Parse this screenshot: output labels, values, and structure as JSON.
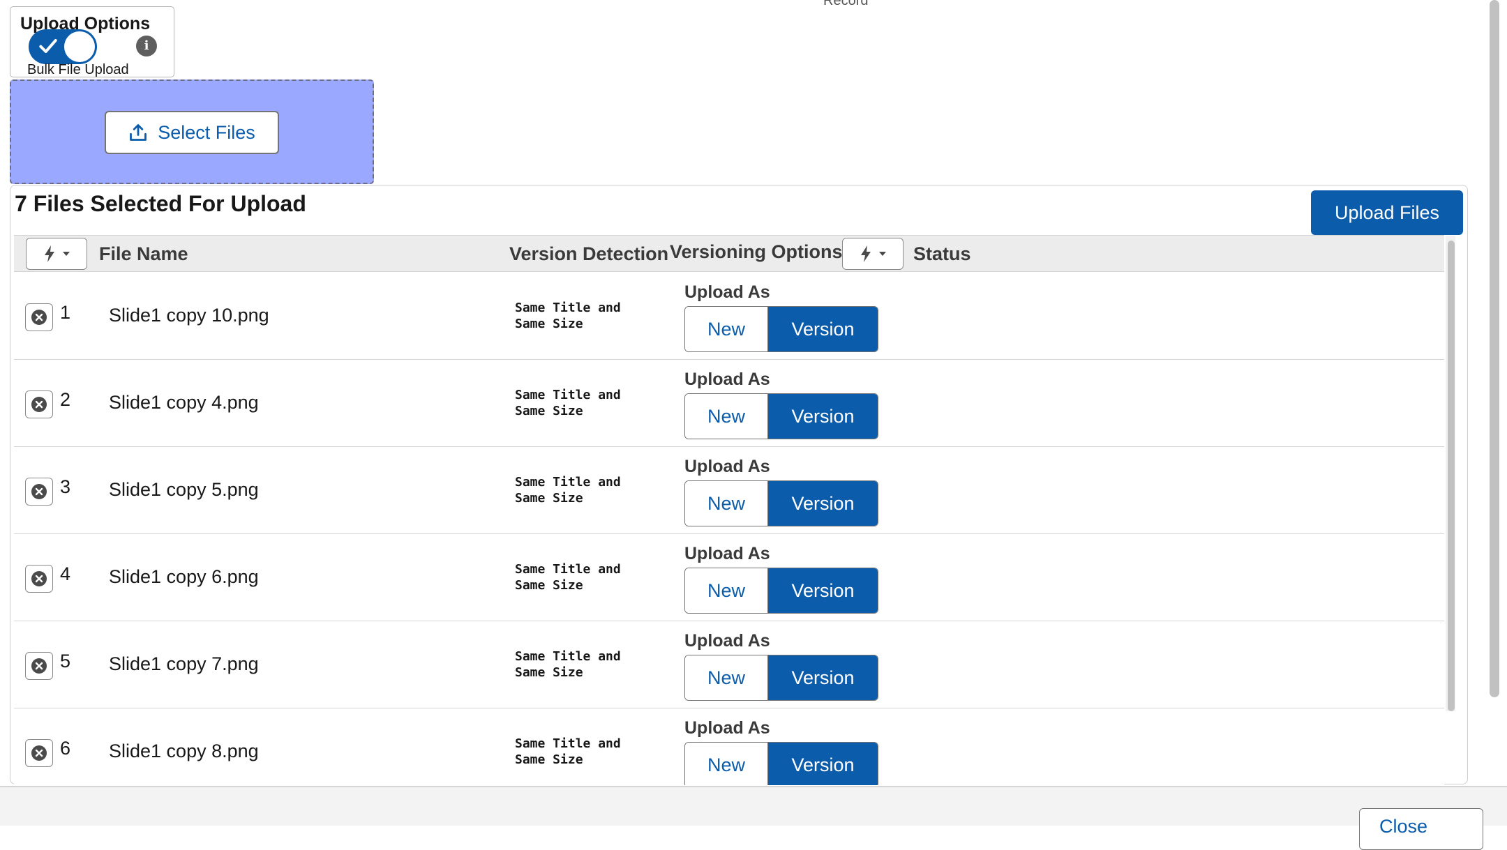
{
  "page": {
    "top_label": "Record"
  },
  "upload_options": {
    "title": "Upload Options",
    "toggle_label": "Bulk File Upload",
    "toggle_on": true,
    "info_glyph": "i"
  },
  "dropzone": {
    "select_label": "Select Files",
    "color": "#9aa9ff"
  },
  "panel": {
    "title": "7 Files Selected For Upload",
    "upload_button": "Upload Files"
  },
  "table": {
    "headers": {
      "file_name": "File Name",
      "version_detection": "Version Detection",
      "versioning_options": "Versioning Options",
      "status": "Status"
    },
    "rows": [
      {
        "num": "1",
        "name": "Slide1 copy 10.png",
        "detect_line1": "Same Title and",
        "detect_line2": "Same Size",
        "upload_as": "Upload As",
        "new_label": "New",
        "version_label": "Version",
        "selected": "Version",
        "status": ""
      },
      {
        "num": "2",
        "name": "Slide1 copy 4.png",
        "detect_line1": "Same Title and",
        "detect_line2": "Same Size",
        "upload_as": "Upload As",
        "new_label": "New",
        "version_label": "Version",
        "selected": "Version",
        "status": ""
      },
      {
        "num": "3",
        "name": "Slide1 copy 5.png",
        "detect_line1": "Same Title and",
        "detect_line2": "Same Size",
        "upload_as": "Upload As",
        "new_label": "New",
        "version_label": "Version",
        "selected": "Version",
        "status": ""
      },
      {
        "num": "4",
        "name": "Slide1 copy 6.png",
        "detect_line1": "Same Title and",
        "detect_line2": "Same Size",
        "upload_as": "Upload As",
        "new_label": "New",
        "version_label": "Version",
        "selected": "Version",
        "status": ""
      },
      {
        "num": "5",
        "name": "Slide1 copy 7.png",
        "detect_line1": "Same Title and",
        "detect_line2": "Same Size",
        "upload_as": "Upload As",
        "new_label": "New",
        "version_label": "Version",
        "selected": "Version",
        "status": ""
      },
      {
        "num": "6",
        "name": "Slide1 copy 8.png",
        "detect_line1": "Same Title and",
        "detect_line2": "Same Size",
        "upload_as": "Upload As",
        "new_label": "New",
        "version_label": "Version",
        "selected": "Version",
        "status": ""
      }
    ]
  },
  "footer": {
    "close_label": "Close"
  },
  "colors": {
    "brand": "#0b5cab",
    "header_bg": "#ececec"
  }
}
